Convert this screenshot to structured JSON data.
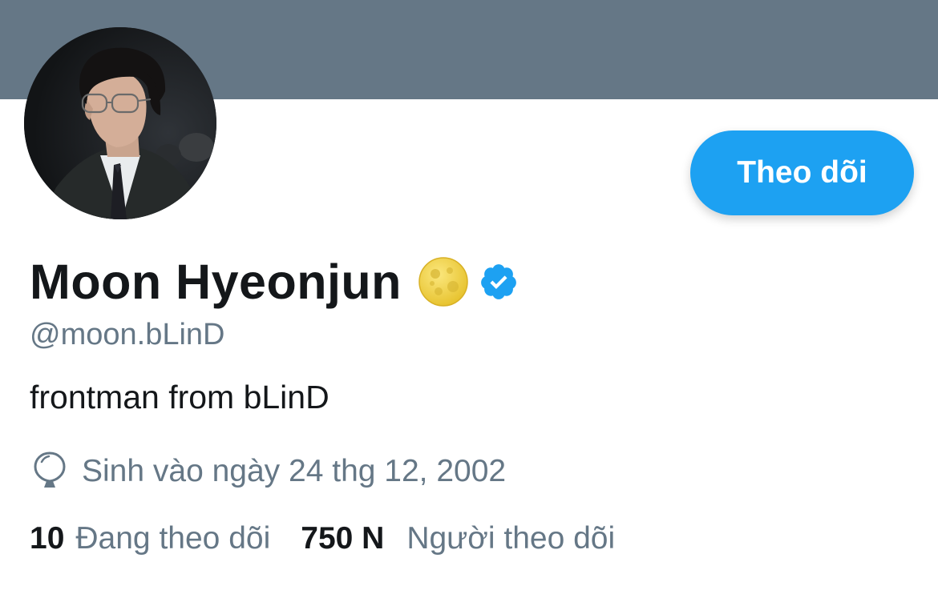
{
  "profile": {
    "display_name": "Moon Hyeonjun",
    "handle": "@moon.bLinD",
    "bio": "frontman from bLinD",
    "birth": "Sinh vào ngày 24 thg 12, 2002",
    "name_emoji": "moon-icon",
    "verified": true
  },
  "actions": {
    "follow_label": "Theo dõi"
  },
  "stats": {
    "following_count": "10",
    "following_label": "Đang theo dõi",
    "followers_count": "750 N",
    "followers_label": "Người theo dõi"
  },
  "colors": {
    "banner": "#657786",
    "accent": "#1da1f2",
    "text_primary": "#14171a",
    "text_secondary": "#657786"
  },
  "icons": {
    "birth": "balloon-icon",
    "verified": "verified-badge-icon",
    "avatar": "avatar"
  }
}
